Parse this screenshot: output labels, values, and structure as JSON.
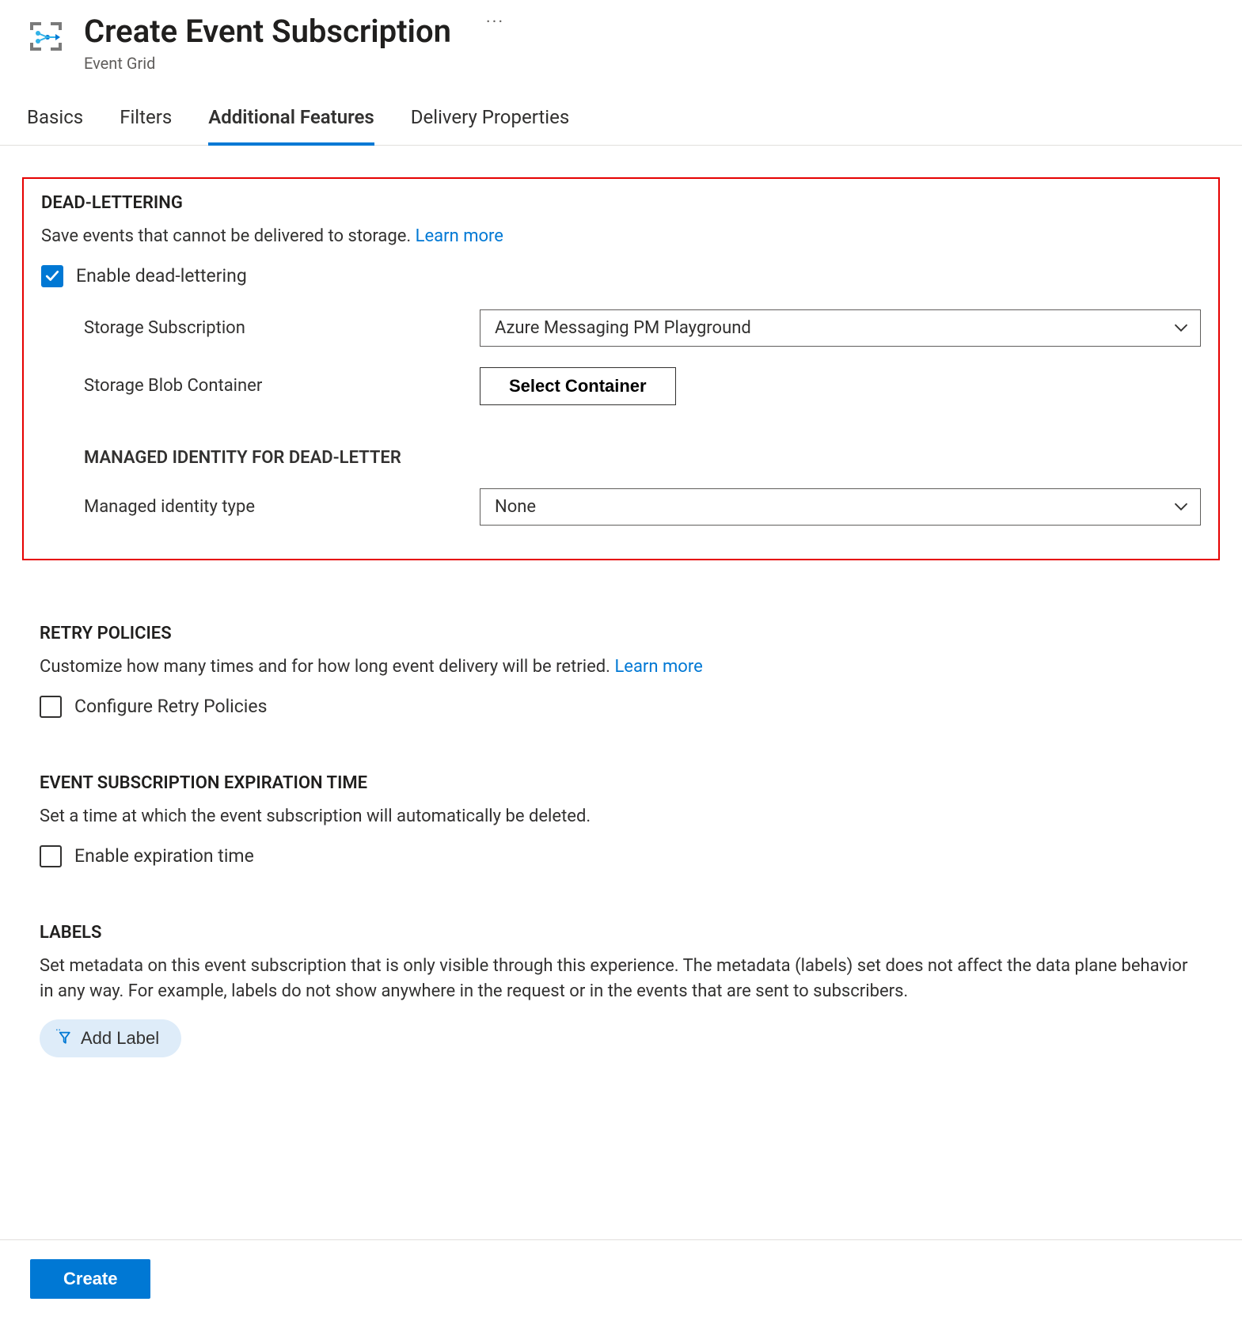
{
  "header": {
    "title": "Create Event Subscription",
    "subtitle": "Event Grid"
  },
  "tabs": [
    {
      "label": "Basics",
      "active": false
    },
    {
      "label": "Filters",
      "active": false
    },
    {
      "label": "Additional Features",
      "active": true
    },
    {
      "label": "Delivery Properties",
      "active": false
    }
  ],
  "deadLettering": {
    "heading": "DEAD-LETTERING",
    "desc": "Save events that cannot be delivered to storage. ",
    "learnMore": "Learn more",
    "enableLabel": "Enable dead-lettering",
    "enabled": true,
    "storageSubscription": {
      "label": "Storage Subscription",
      "value": "Azure Messaging PM Playground"
    },
    "storageBlobContainer": {
      "label": "Storage Blob Container",
      "button": "Select Container"
    },
    "managedIdentity": {
      "heading": "MANAGED IDENTITY FOR DEAD-LETTER",
      "typeLabel": "Managed identity type",
      "typeValue": "None"
    }
  },
  "retry": {
    "heading": "RETRY POLICIES",
    "desc": "Customize how many times and for how long event delivery will be retried. ",
    "learnMore": "Learn more",
    "checkboxLabel": "Configure Retry Policies",
    "checked": false
  },
  "expiration": {
    "heading": "EVENT SUBSCRIPTION EXPIRATION TIME",
    "desc": "Set a time at which the event subscription will automatically be deleted.",
    "checkboxLabel": "Enable expiration time",
    "checked": false
  },
  "labels": {
    "heading": "LABELS",
    "desc": "Set metadata on this event subscription that is only visible through this experience. The metadata (labels) set does not affect the data plane behavior in any way. For example, labels do not show anywhere in the request or in the events that are sent to subscribers.",
    "addButton": "Add Label"
  },
  "footer": {
    "create": "Create"
  }
}
